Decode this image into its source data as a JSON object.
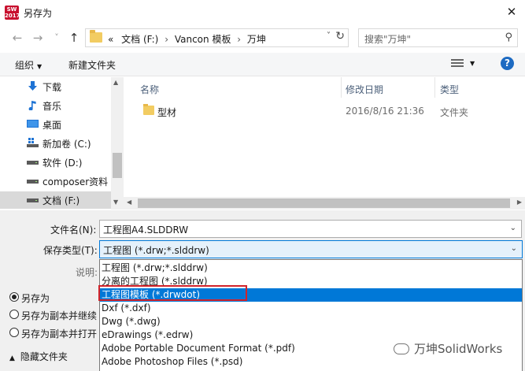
{
  "window": {
    "title": "另存为",
    "app_badge": "SW\n2017",
    "close_glyph": "✕"
  },
  "nav": {
    "back": "←",
    "forward": "→",
    "recent": "˅",
    "up": "↑",
    "breadcrumb": [
      "«",
      "文档 (F:)",
      "›",
      "Vancon 模板",
      "›",
      "万坤"
    ],
    "dropdown": "˅",
    "refresh": "↻",
    "search_placeholder": "搜索\"万坤\"",
    "search_icon": "⚲"
  },
  "toolbar": {
    "organize": "组织",
    "organize_caret": "▼",
    "new_folder": "新建文件夹",
    "view_caret": "▼",
    "help": "?"
  },
  "sidebar": {
    "items": [
      {
        "label": "下载",
        "icon": "download-icon"
      },
      {
        "label": "音乐",
        "icon": "music-icon"
      },
      {
        "label": "桌面",
        "icon": "desktop-icon"
      },
      {
        "label": "新加卷 (C:)",
        "icon": "drive-c-icon"
      },
      {
        "label": "软件 (D:)",
        "icon": "drive-icon"
      },
      {
        "label": "composer资料",
        "icon": "drive-icon"
      },
      {
        "label": "文档 (F:)",
        "icon": "drive-icon",
        "selected": true
      }
    ]
  },
  "file_list": {
    "columns": [
      "名称",
      "修改日期",
      "类型"
    ],
    "rows": [
      {
        "name": "型材",
        "modified": "2016/8/16 21:36",
        "type": "文件夹"
      }
    ]
  },
  "form": {
    "filename_label": "文件名(N):",
    "filename_value": "工程图A4.SLDDRW",
    "filetype_label": "保存类型(T):",
    "filetype_value": "工程图 (*.drw;*.slddrw)",
    "description_label": "说明:",
    "caret": "⌄"
  },
  "options": {
    "radios": [
      {
        "label": "另存为",
        "checked": true
      },
      {
        "label": "另存为副本并继续",
        "checked": false
      },
      {
        "label": "另存为副本并打开",
        "checked": false
      }
    ],
    "hide_folders_caret": "▲",
    "hide_folders": "隐藏文件夹"
  },
  "filetype_options": [
    "工程图 (*.drw;*.slddrw)",
    "分离的工程图 (*.slddrw)",
    "工程图模板 (*.drwdot)",
    "Dxf (*.dxf)",
    "Dwg (*.dwg)",
    "eDrawings (*.edrw)",
    "Adobe Portable Document Format (*.pdf)",
    "Adobe Photoshop Files (*.psd)"
  ],
  "highlighted_option_index": 2,
  "watermark": {
    "text": "万坤SolidWorks"
  },
  "colors": {
    "accent": "#0078d7",
    "highlight_box": "#d2232a",
    "folder": "#f2cc62"
  }
}
